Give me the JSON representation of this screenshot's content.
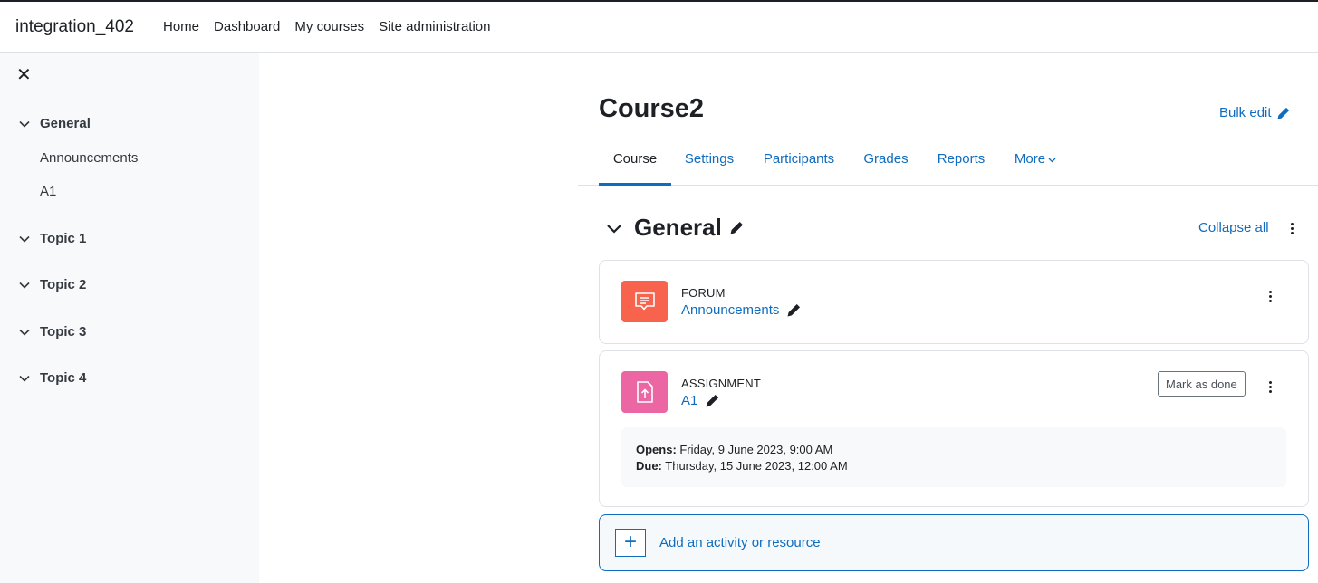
{
  "topbar": {
    "site_name": "integration_402",
    "nav": [
      "Home",
      "Dashboard",
      "My courses",
      "Site administration"
    ]
  },
  "drawer": {
    "close_icon": "close-icon",
    "sections": [
      {
        "label": "General",
        "items": [
          "Announcements",
          "A1"
        ]
      },
      {
        "label": "Topic 1",
        "items": []
      },
      {
        "label": "Topic 2",
        "items": []
      },
      {
        "label": "Topic 3",
        "items": []
      },
      {
        "label": "Topic 4",
        "items": []
      }
    ]
  },
  "course": {
    "title": "Course2",
    "bulk_edit": "Bulk edit",
    "tabs": [
      "Course",
      "Settings",
      "Participants",
      "Grades",
      "Reports",
      "More"
    ],
    "active_tab": "Course"
  },
  "section": {
    "title": "General",
    "collapse_all": "Collapse all"
  },
  "activities": [
    {
      "type": "FORUM",
      "name": "Announcements",
      "icon": "forum-icon",
      "color": "#f7634d"
    },
    {
      "type": "ASSIGNMENT",
      "name": "A1",
      "icon": "assignment-icon",
      "color": "#eb66a2",
      "mark_done": "Mark as done",
      "opens_label": "Opens:",
      "opens_value": " Friday, 9 June 2023, 9:00 AM",
      "due_label": "Due:",
      "due_value": " Thursday, 15 June 2023, 12:00 AM"
    }
  ],
  "add_activity": {
    "plus": "+",
    "label": "Add an activity or resource"
  },
  "colors": {
    "accent": "#0f6cbf",
    "forum": "#f7634d",
    "assignment": "#eb66a2"
  }
}
